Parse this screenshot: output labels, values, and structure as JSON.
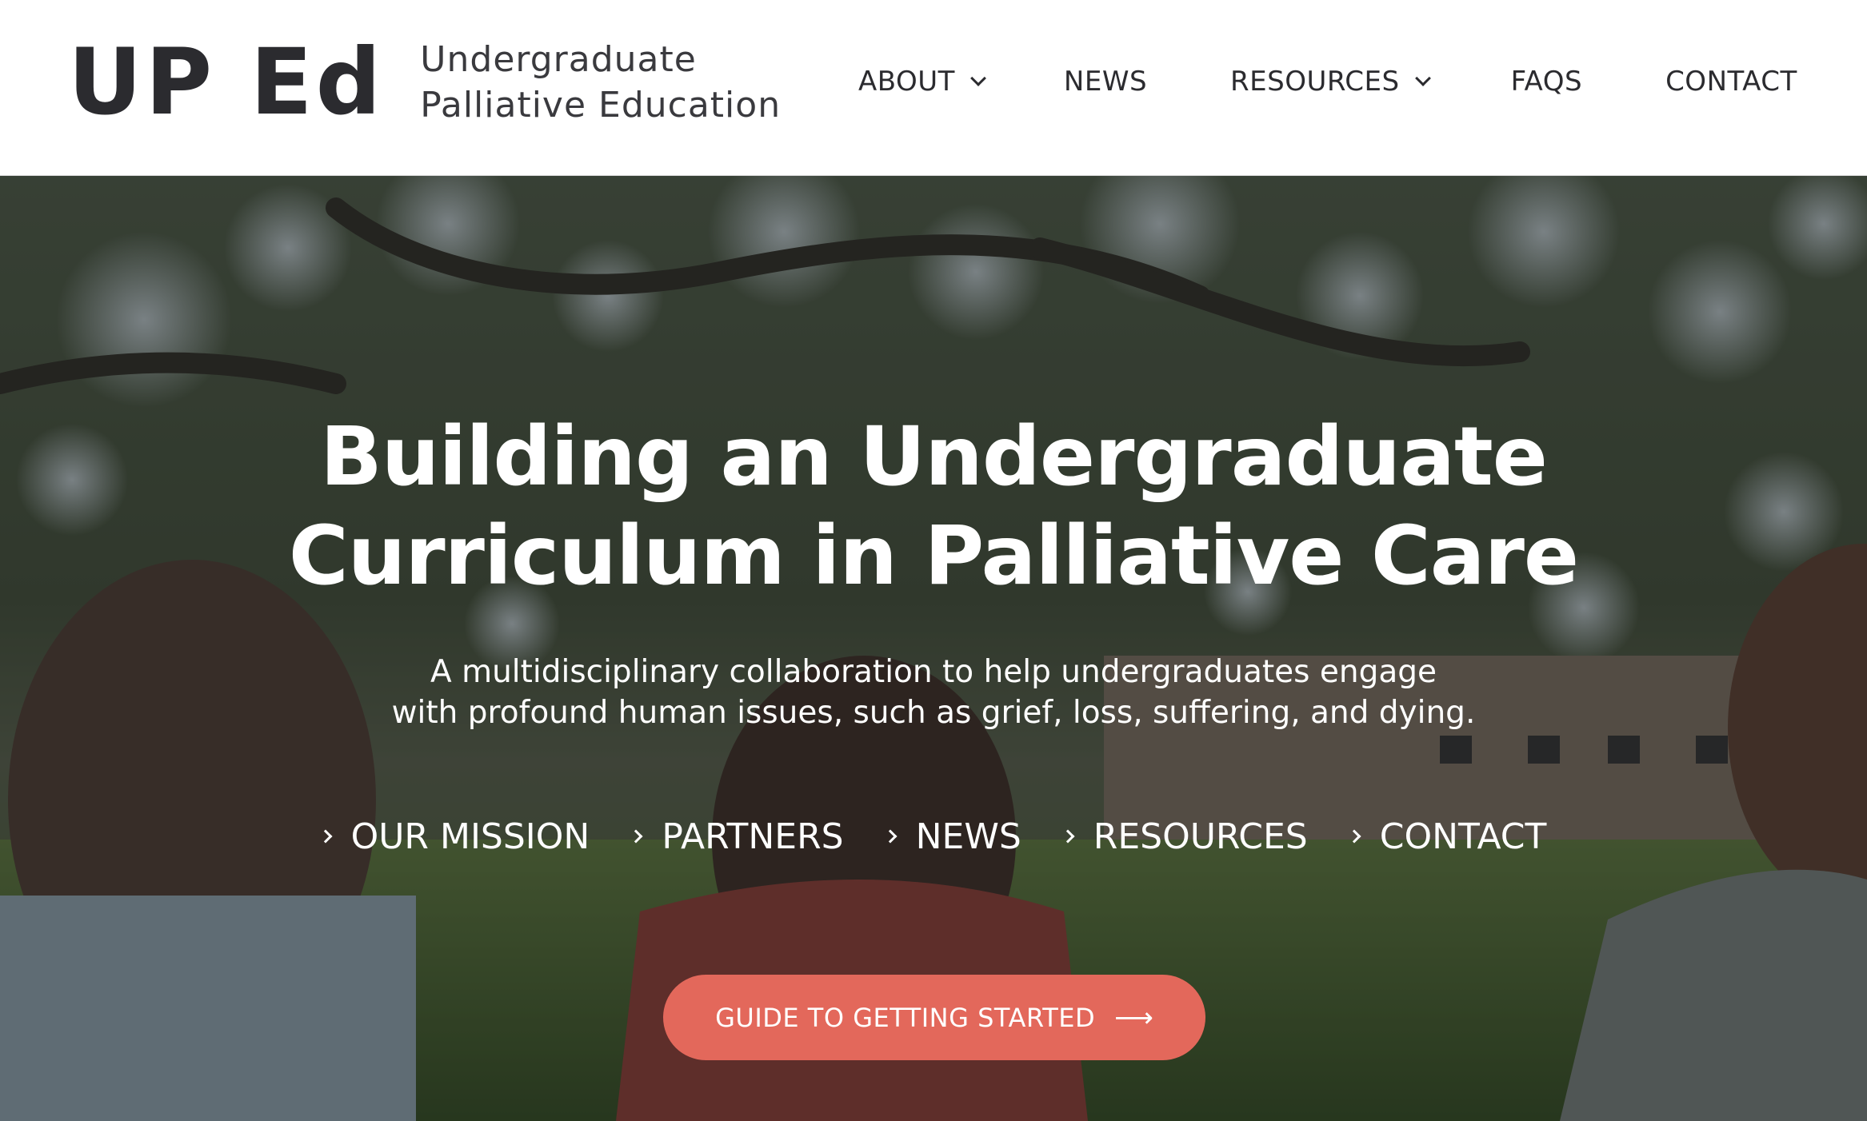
{
  "header": {
    "logo": {
      "mark": "UP Ed",
      "line1": "Undergraduate",
      "line2": "Palliative Education"
    },
    "nav": [
      {
        "label": "ABOUT",
        "has_dropdown": true
      },
      {
        "label": "NEWS",
        "has_dropdown": false
      },
      {
        "label": "RESOURCES",
        "has_dropdown": true
      },
      {
        "label": "FAQS",
        "has_dropdown": false
      },
      {
        "label": "CONTACT",
        "has_dropdown": false
      }
    ]
  },
  "hero": {
    "title_line1": "Building an Undergraduate",
    "title_line2": "Curriculum in Palliative Care",
    "subtitle_line1": "A multidisciplinary collaboration to help undergraduates engage",
    "subtitle_line2": "with profound human issues, such as grief, loss, suffering, and dying.",
    "quick_links": [
      "OUR MISSION",
      "PARTNERS",
      "NEWS",
      "RESOURCES",
      "CONTACT"
    ],
    "cta": {
      "label": "GUIDE TO GETTING STARTED",
      "icon": "arrow-right-icon",
      "color": "#e3685b"
    }
  }
}
